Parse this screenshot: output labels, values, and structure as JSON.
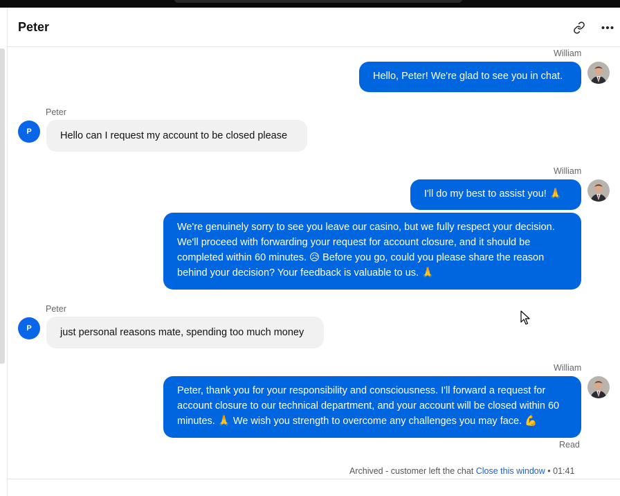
{
  "header": {
    "title": "Peter",
    "link_icon": "link-icon",
    "more_icon": "more-horizontal-icon"
  },
  "colors": {
    "agent_bubble": "#0066e0",
    "customer_bubble": "#f1f1f1",
    "customer_avatar": "#0a66e8",
    "link": "#1a5fd8"
  },
  "messages": [
    {
      "sender": "William",
      "text": "Hello, Peter! We're glad to see you in chat."
    },
    {
      "sender": "Peter",
      "avatar": "P",
      "text": "Hello can I request my account to be closed please"
    },
    {
      "sender": "William",
      "text": "I'll do my best to assist you! 🙏"
    },
    {
      "text": "We're genuinely sorry to see you leave our casino, but we fully respect your decision. We'll proceed with forwarding your request for account closure, and it should be completed within 60 minutes. 😥 Before you go, could you please share the reason behind your decision? Your feedback is valuable to us. 🙏"
    },
    {
      "sender": "Peter",
      "avatar": "P",
      "text": "just personal reasons mate, spending too much money"
    },
    {
      "sender": "William",
      "text": "Peter, thank you for your responsibility and consciousness. I'll forward a request for account closure to our technical department, and your account will be closed within 60 minutes. 🙏 We wish you strength to overcome any challenges you may face. 💪"
    }
  ],
  "read_status": "Read",
  "footer": {
    "status": "Archived - customer left the chat",
    "close_link": "Close this window",
    "separator": "•",
    "time": "01:41"
  }
}
